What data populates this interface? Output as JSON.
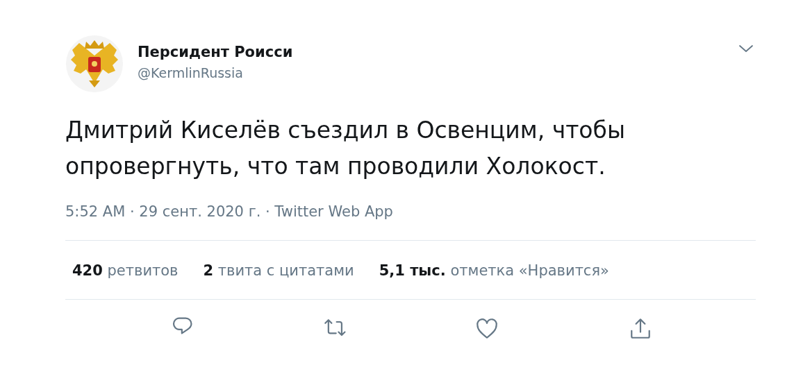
{
  "author": {
    "name": "Персидент Роисси",
    "handle": "@KermlinRussia"
  },
  "tweet": {
    "text": "Дмитрий Киселёв съездил в Освенцим, чтобы опровергнуть, что там проводили Холокост.",
    "meta": "5:52 AM · 29 сент. 2020 г. · Twitter Web App"
  },
  "stats": [
    {
      "count": "420",
      "label": "ретвитов"
    },
    {
      "count": "2",
      "label": "твита с цитатами"
    },
    {
      "count": "5,1 тыс.",
      "label": "отметка «Нравится»"
    }
  ],
  "actions": [
    {
      "kind": "reply"
    },
    {
      "kind": "retweet"
    },
    {
      "kind": "like"
    },
    {
      "kind": "share"
    }
  ]
}
